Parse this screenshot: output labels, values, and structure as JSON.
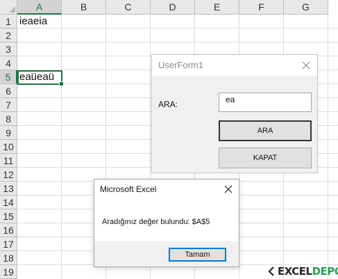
{
  "spreadsheet": {
    "columns": [
      "A",
      "B",
      "C",
      "D",
      "E",
      "F",
      "G"
    ],
    "rows": [
      "1",
      "2",
      "3",
      "4",
      "5",
      "6",
      "7",
      "8",
      "9",
      "10",
      "11",
      "12",
      "13",
      "14",
      "15",
      "16",
      "17",
      "18",
      "19"
    ],
    "selected_column": "A",
    "selected_row": "5",
    "cells": {
      "A1": "ieaeia",
      "A5": "eaüeaü"
    },
    "accent_color": "#217346"
  },
  "userform": {
    "title": "UserForm1",
    "search_label": "ARA:",
    "search_value": "ea",
    "ara_button": "ARA",
    "kapat_button": "KAPAT"
  },
  "message_box": {
    "title": "Microsoft Excel",
    "message": "Aradığınız değer bulundu: $A$5",
    "ok_button": "Tamam",
    "focus_color": "#0078d7"
  },
  "logo": {
    "part1": "EXCEL",
    "part2": "DEPO",
    "brand_color": "#2f9e55"
  }
}
